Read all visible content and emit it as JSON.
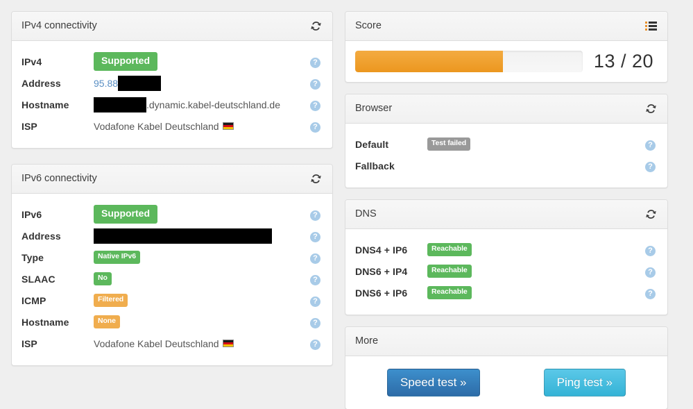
{
  "ipv4_panel": {
    "title": "IPv4 connectivity",
    "refresh_icon": "refresh-icon",
    "rows": [
      {
        "label": "IPv4",
        "kind": "badge",
        "badge_text": "Supported",
        "badge_color": "green",
        "badge_size": "lg",
        "help": "?"
      },
      {
        "label": "Address",
        "kind": "redact_after",
        "prefix": "95.88",
        "redact_width": 62,
        "help": "?"
      },
      {
        "label": "Hostname",
        "kind": "redact_before",
        "redact_width": 76,
        "suffix": ".dynamic.kabel-deutschland.de",
        "help": "?"
      },
      {
        "label": "ISP",
        "kind": "text_flag",
        "text": "Vodafone Kabel Deutschland",
        "flag": "de-flag-icon",
        "help": "?"
      }
    ]
  },
  "ipv6_panel": {
    "title": "IPv6 connectivity",
    "refresh_icon": "refresh-icon",
    "rows": [
      {
        "label": "IPv6",
        "kind": "badge",
        "badge_text": "Supported",
        "badge_color": "green",
        "badge_size": "lg",
        "help": "?"
      },
      {
        "label": "Address",
        "kind": "redact_only",
        "redact_width": 257,
        "help": "?"
      },
      {
        "label": "Type",
        "kind": "badge",
        "badge_text": "Native IPv6",
        "badge_color": "green",
        "badge_size": "sm",
        "help": "?"
      },
      {
        "label": "SLAAC",
        "kind": "badge",
        "badge_text": "No",
        "badge_color": "green",
        "badge_size": "sm",
        "help": "?"
      },
      {
        "label": "ICMP",
        "kind": "badge",
        "badge_text": "Filtered",
        "badge_color": "orange",
        "badge_size": "sm",
        "help": "?"
      },
      {
        "label": "Hostname",
        "kind": "badge",
        "badge_text": "None",
        "badge_color": "orange",
        "badge_size": "sm",
        "help": "?"
      },
      {
        "label": "ISP",
        "kind": "text_flag",
        "text": "Vodafone Kabel Deutschland",
        "flag": "de-flag-icon",
        "help": "?"
      }
    ]
  },
  "score_panel": {
    "title": "Score",
    "list_icon": "list-icon",
    "score_value": 13,
    "score_max": 20,
    "score_text": "13 / 20",
    "progress_percent": 65,
    "progress_color": "#ec971f"
  },
  "browser_panel": {
    "title": "Browser",
    "refresh_icon": "refresh-icon",
    "rows": [
      {
        "label": "Default",
        "kind": "badge",
        "badge_text": "Test failed",
        "badge_color": "gray",
        "badge_size": "sm",
        "help": "?"
      },
      {
        "label": "Fallback",
        "kind": "empty",
        "help": "?"
      }
    ]
  },
  "dns_panel": {
    "title": "DNS",
    "refresh_icon": "refresh-icon",
    "rows": [
      {
        "label": "DNS4 + IP6",
        "kind": "badge",
        "badge_text": "Reachable",
        "badge_color": "green",
        "badge_size": "sm",
        "help": "?"
      },
      {
        "label": "DNS6 + IP4",
        "kind": "badge",
        "badge_text": "Reachable",
        "badge_color": "green",
        "badge_size": "sm",
        "help": "?"
      },
      {
        "label": "DNS6 + IP6",
        "kind": "badge",
        "badge_text": "Reachable",
        "badge_color": "green",
        "badge_size": "sm",
        "help": "?"
      }
    ]
  },
  "more_panel": {
    "title": "More",
    "speed_test_label": "Speed test »",
    "ping_test_label": "Ping test »"
  },
  "colors": {
    "page_background": "#efefef",
    "panel_background": "#ffffff",
    "panel_border": "#dddddd",
    "badge_green": "#5cb85c",
    "badge_orange": "#f0ad4e",
    "badge_gray": "#999999",
    "progress_orange": "#ec971f",
    "link_blue": "#5a8fc4",
    "help_blue": "#a8cbe8",
    "btn_primary": "#2d6ca8",
    "btn_info": "#34b3d6"
  }
}
